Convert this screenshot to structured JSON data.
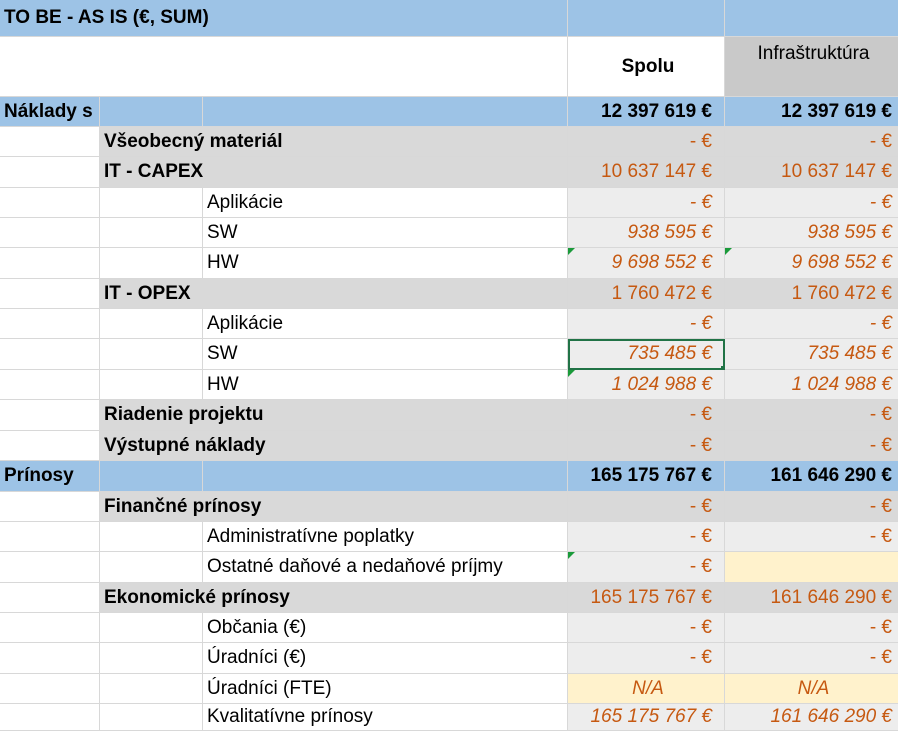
{
  "title": "TO BE - AS IS (€, SUM)",
  "columns": {
    "spolu": "Spolu",
    "infra": "Infraštruktúra"
  },
  "rows": [
    {
      "label": "Náklady s DPH",
      "spolu": "12 397 619 €",
      "infra": "12 397 619 €"
    },
    {
      "label": "Všeobecný materiál",
      "spolu": "- €",
      "infra": "- €"
    },
    {
      "label": "IT - CAPEX",
      "spolu": "10 637 147 €",
      "infra": "10 637 147 €"
    },
    {
      "label": "Aplikácie",
      "spolu": "- €",
      "infra": "- €"
    },
    {
      "label": "SW",
      "spolu": "938 595 €",
      "infra": "938 595 €"
    },
    {
      "label": "HW",
      "spolu": "9 698 552 €",
      "infra": "9 698 552 €"
    },
    {
      "label": "IT - OPEX",
      "spolu": "1 760 472 €",
      "infra": "1 760 472 €"
    },
    {
      "label": "Aplikácie",
      "spolu": "- €",
      "infra": "- €"
    },
    {
      "label": "SW",
      "spolu": "735 485 €",
      "infra": "735 485 €"
    },
    {
      "label": "HW",
      "spolu": "1 024 988 €",
      "infra": "1 024 988 €"
    },
    {
      "label": "Riadenie projektu",
      "spolu": "- €",
      "infra": "- €"
    },
    {
      "label": "Výstupné náklady",
      "spolu": "- €",
      "infra": "- €"
    },
    {
      "label": "Prínosy",
      "spolu": "165 175 767 €",
      "infra": "161 646 290 €"
    },
    {
      "label": "Finančné prínosy",
      "spolu": "- €",
      "infra": "- €"
    },
    {
      "label": "Administratívne poplatky",
      "spolu": "- €",
      "infra": "- €"
    },
    {
      "label": "Ostatné daňové a nedaňové príjmy",
      "spolu": "- €",
      "infra": ""
    },
    {
      "label": "Ekonomické prínosy",
      "spolu": "165 175 767 €",
      "infra": "161 646 290 €"
    },
    {
      "label": "Občania (€)",
      "spolu": "- €",
      "infra": "- €"
    },
    {
      "label": "Úradníci (€)",
      "spolu": "- €",
      "infra": "- €"
    },
    {
      "label": "Úradníci (FTE)",
      "spolu": "N/A",
      "infra": "N/A"
    },
    {
      "label": "Kvalitatívne prínosy",
      "spolu": "165 175 767 €",
      "infra": "161 646 290 €"
    }
  ]
}
